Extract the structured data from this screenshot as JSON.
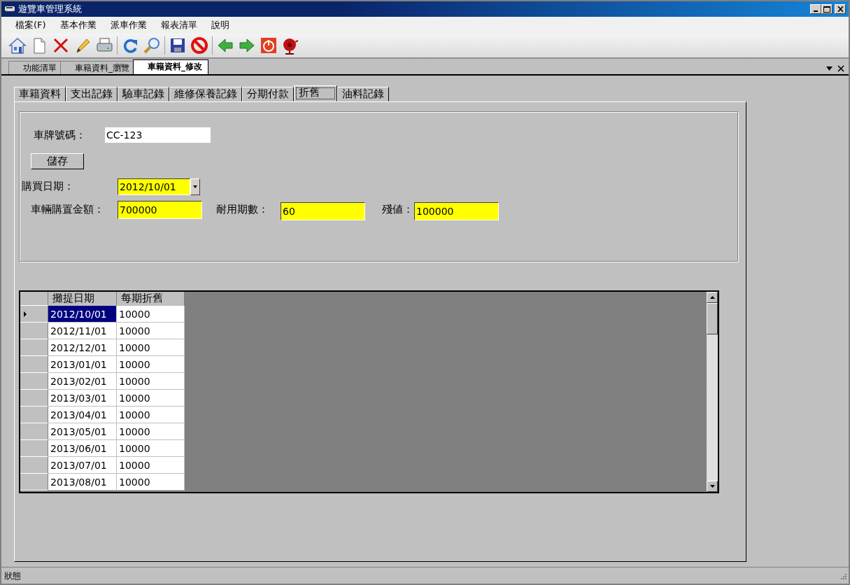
{
  "window": {
    "title": "遊覽車管理系統"
  },
  "menu": [
    "檔案(F)",
    "基本作業",
    "派車作業",
    "報表清單",
    "說明"
  ],
  "doc_tabs": [
    {
      "label": "功能清單",
      "selected": false
    },
    {
      "label": "車籍資料_瀏覽",
      "selected": false
    },
    {
      "label": "車籍資料_修改",
      "selected": true
    }
  ],
  "tabs": [
    {
      "label": "車籍資料",
      "selected": false
    },
    {
      "label": "支出記錄",
      "selected": false
    },
    {
      "label": "驗車記錄",
      "selected": false
    },
    {
      "label": "維修保養記錄",
      "selected": false
    },
    {
      "label": "分期付款",
      "selected": false
    },
    {
      "label": "折舊",
      "selected": true
    },
    {
      "label": "油料記錄",
      "selected": false
    }
  ],
  "form": {
    "plate_label": "車牌號碼：",
    "plate_value": "CC-123",
    "save_button": "儲存",
    "purchase_date_label": "購買日期：",
    "purchase_date_value": "2012/10/01",
    "amount_label": "車輛購置金額：",
    "amount_value": "700000",
    "periods_label": "耐用期數：",
    "periods_value": "60",
    "residual_label": "殘値：",
    "residual_value": "100000"
  },
  "table": {
    "columns": [
      "攤提日期",
      "每期折舊"
    ],
    "rows": [
      {
        "cells": [
          "2012/10/01",
          "10000"
        ],
        "selected": true
      },
      {
        "cells": [
          "2012/11/01",
          "10000"
        ],
        "selected": false
      },
      {
        "cells": [
          "2012/12/01",
          "10000"
        ],
        "selected": false
      },
      {
        "cells": [
          "2013/01/01",
          "10000"
        ],
        "selected": false
      },
      {
        "cells": [
          "2013/02/01",
          "10000"
        ],
        "selected": false
      },
      {
        "cells": [
          "2013/03/01",
          "10000"
        ],
        "selected": false
      },
      {
        "cells": [
          "2013/04/01",
          "10000"
        ],
        "selected": false
      },
      {
        "cells": [
          "2013/05/01",
          "10000"
        ],
        "selected": false
      },
      {
        "cells": [
          "2013/06/01",
          "10000"
        ],
        "selected": false
      },
      {
        "cells": [
          "2013/07/01",
          "10000"
        ],
        "selected": false
      },
      {
        "cells": [
          "2013/08/01",
          "10000"
        ],
        "selected": false
      }
    ]
  },
  "status_bar": "狀態"
}
